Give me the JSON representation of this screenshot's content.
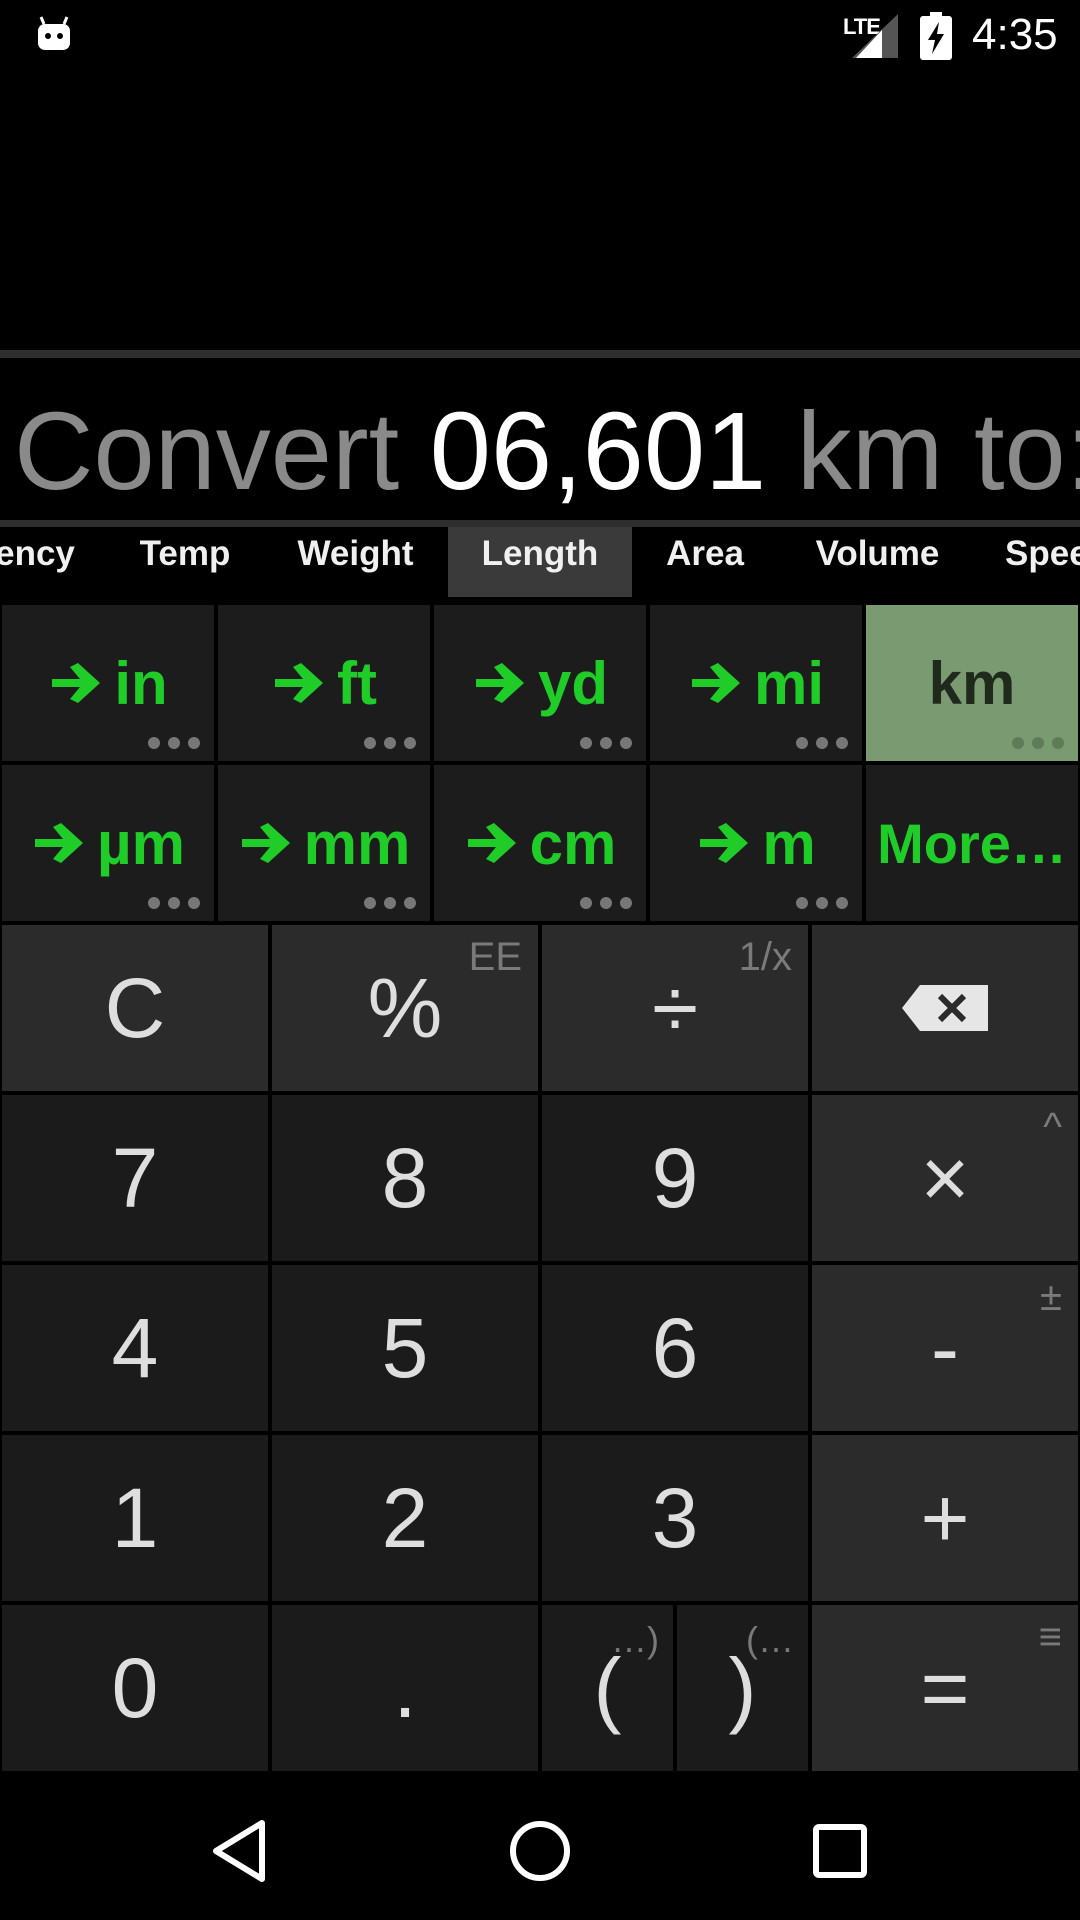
{
  "status_bar": {
    "network": "LTE",
    "time": "4:35"
  },
  "conversion": {
    "prefix": "Convert",
    "value": "06,601",
    "unit": "km",
    "suffix": "to:"
  },
  "tabs": [
    "ency",
    "Temp",
    "Weight",
    "Length",
    "Area",
    "Volume",
    "Spee"
  ],
  "active_tab": "Length",
  "units": [
    {
      "label": "in",
      "arrow": true
    },
    {
      "label": "ft",
      "arrow": true
    },
    {
      "label": "yd",
      "arrow": true
    },
    {
      "label": "mi",
      "arrow": true
    },
    {
      "label": "km",
      "arrow": false,
      "selected": true
    },
    {
      "label": "µm",
      "arrow": true
    },
    {
      "label": "mm",
      "arrow": true
    },
    {
      "label": "cm",
      "arrow": true
    },
    {
      "label": "m",
      "arrow": true
    },
    {
      "label": "More…",
      "arrow": false
    }
  ],
  "keys": {
    "clear": "C",
    "percent": "%",
    "percent_alt": "EE",
    "divide": "÷",
    "divide_alt": "1/x",
    "seven": "7",
    "eight": "8",
    "nine": "9",
    "multiply": "×",
    "multiply_alt": "^",
    "four": "4",
    "five": "5",
    "six": "6",
    "minus": "-",
    "minus_alt": "±",
    "one": "1",
    "two": "2",
    "three": "3",
    "plus": "+",
    "zero": "0",
    "dot": ".",
    "open_paren": "(",
    "open_paren_alt": "…)",
    "close_paren": ")",
    "close_paren_alt": "(…",
    "equals": "=",
    "equals_alt": "≡"
  },
  "colors": {
    "accent_green": "#1fcc28",
    "selected_unit_bg": "#7a9b72"
  }
}
